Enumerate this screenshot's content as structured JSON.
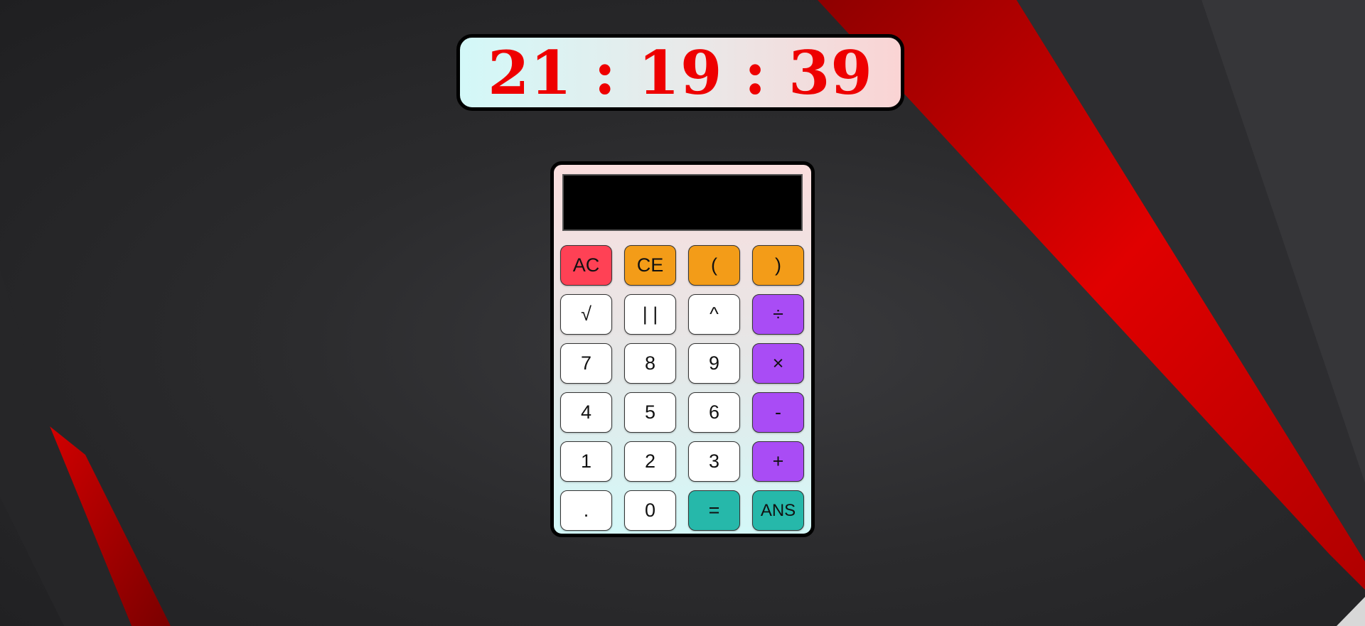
{
  "colors": {
    "clock_digits": "#ee0000",
    "ac_key": "#ff4155",
    "paren_key": "#f39c18",
    "operator_key": "#a94cf5",
    "equals_key": "#26b8aa",
    "digit_key": "#ffffff",
    "display": "#000000"
  },
  "clock": {
    "time": "21 : 19 : 39"
  },
  "calculator": {
    "display_value": "",
    "keys": [
      {
        "label": "AC",
        "name": "all-clear-button",
        "style": "red"
      },
      {
        "label": "CE",
        "name": "clear-entry-button",
        "style": "orange"
      },
      {
        "label": "(",
        "name": "open-paren-button",
        "style": "orange"
      },
      {
        "label": ")",
        "name": "close-paren-button",
        "style": "orange"
      },
      {
        "label": "√",
        "name": "square-root-button",
        "style": ""
      },
      {
        "label": "| |",
        "name": "absolute-value-button",
        "style": ""
      },
      {
        "label": "^",
        "name": "power-button",
        "style": ""
      },
      {
        "label": "÷",
        "name": "divide-button",
        "style": "purple"
      },
      {
        "label": "7",
        "name": "digit-7-button",
        "style": ""
      },
      {
        "label": "8",
        "name": "digit-8-button",
        "style": ""
      },
      {
        "label": "9",
        "name": "digit-9-button",
        "style": ""
      },
      {
        "label": "×",
        "name": "multiply-button",
        "style": "purple"
      },
      {
        "label": "4",
        "name": "digit-4-button",
        "style": ""
      },
      {
        "label": "5",
        "name": "digit-5-button",
        "style": ""
      },
      {
        "label": "6",
        "name": "digit-6-button",
        "style": ""
      },
      {
        "label": "-",
        "name": "subtract-button",
        "style": "purple"
      },
      {
        "label": "1",
        "name": "digit-1-button",
        "style": ""
      },
      {
        "label": "2",
        "name": "digit-2-button",
        "style": ""
      },
      {
        "label": "3",
        "name": "digit-3-button",
        "style": ""
      },
      {
        "label": "+",
        "name": "add-button",
        "style": "purple"
      },
      {
        "label": ".",
        "name": "decimal-point-button",
        "style": ""
      },
      {
        "label": "0",
        "name": "digit-0-button",
        "style": ""
      },
      {
        "label": "=",
        "name": "equals-button",
        "style": "teal"
      },
      {
        "label": "ANS",
        "name": "answer-button",
        "style": "teal small"
      }
    ]
  }
}
